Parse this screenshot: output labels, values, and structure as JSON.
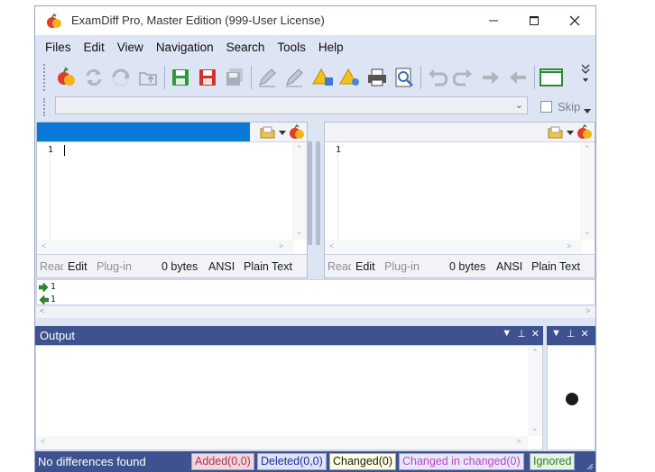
{
  "window": {
    "title": "ExamDiff Pro, Master Edition (999-User License)"
  },
  "menu": [
    "Files",
    "Edit",
    "View",
    "Navigation",
    "Search",
    "Tools",
    "Help"
  ],
  "skip": {
    "label": "Skip",
    "checked": false
  },
  "left_pane": {
    "line_number": "1",
    "status": {
      "read": "Read",
      "edit": "Edit",
      "plugin": "Plug-in",
      "size": "0 bytes",
      "encoding": "ANSI",
      "type": "Plain Text"
    }
  },
  "right_pane": {
    "line_number": "1",
    "status": {
      "read": "Read",
      "edit": "Edit",
      "plugin": "Plug-in",
      "size": "0 bytes",
      "encoding": "ANSI",
      "type": "Plain Text"
    }
  },
  "diff_strip": {
    "row1": "1",
    "row2": "1"
  },
  "output": {
    "title": "Output"
  },
  "status": {
    "message": "No differences found",
    "added": "Added(0,0)",
    "deleted": "Deleted(0,0)",
    "changed": "Changed(0)",
    "changed_in_changed": "Changed in changed(0)",
    "ignored": "Ignored"
  },
  "colors": {
    "added": "#b03050",
    "added_bg": "#f0d8dc",
    "deleted": "#1f2fa0",
    "deleted_bg": "#dfe3f7",
    "changed": "#1a1a1a",
    "changed_bg": "#fdfde0",
    "changed_in_changed": "#c046c0",
    "changed_in_changed_bg": "#e8e6fb",
    "ignored": "#2e7d2e",
    "ignored_bg": "#e7f4e2",
    "active_header": "#0a78d7",
    "panel_header": "#3e5290"
  }
}
